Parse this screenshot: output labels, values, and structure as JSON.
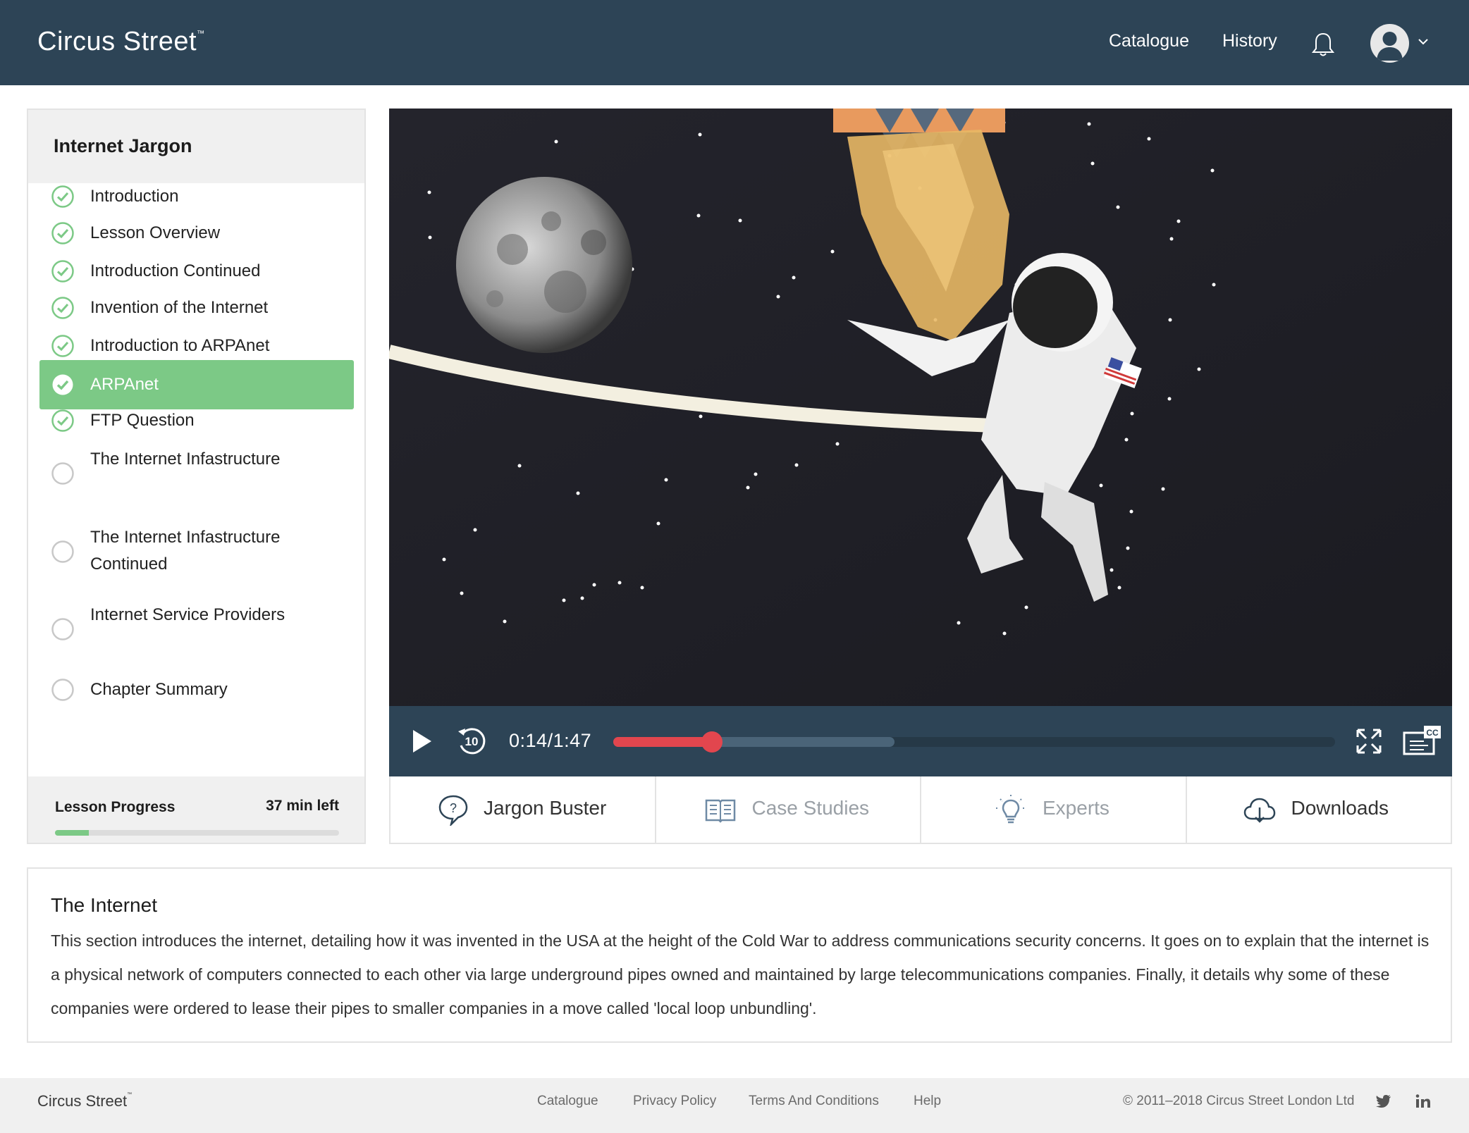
{
  "header": {
    "logo": "Circus Street",
    "logo_mark": "™",
    "nav": [
      {
        "label": "Catalogue"
      },
      {
        "label": "History"
      }
    ],
    "bell_icon": "bell-icon",
    "avatar_icon": "user-avatar-icon"
  },
  "sidebar": {
    "title": "Internet Jargon",
    "lessons": [
      {
        "label": "Introduction",
        "status": "completed"
      },
      {
        "label": "Lesson Overview",
        "status": "completed"
      },
      {
        "label": "Introduction Continued",
        "status": "completed"
      },
      {
        "label": "Invention of the Internet",
        "status": "completed"
      },
      {
        "label": "Introduction to ARPAnet",
        "status": "completed"
      },
      {
        "label": "ARPAnet",
        "status": "current"
      },
      {
        "label": "FTP Question",
        "status": "completed"
      },
      {
        "label": "The Internet Infastructure",
        "status": "not-started"
      },
      {
        "label": "The Internet Infastructure Continued",
        "status": "not-started"
      },
      {
        "label": "Internet Service Providers",
        "status": "not-started"
      },
      {
        "label": "Chapter Summary",
        "status": "not-started"
      }
    ],
    "progress": {
      "label": "Lesson Progress",
      "remaining": "37 min left",
      "fraction": 0.12
    }
  },
  "player": {
    "current_time": "0:14",
    "separator": "/",
    "duration": "1:47",
    "played_fraction": 0.137,
    "buffered_fraction": 0.39,
    "rewind_label": "10",
    "cc_label": "CC"
  },
  "tabs": [
    {
      "label": "Jargon Buster",
      "icon": "question-bubble-icon"
    },
    {
      "label": "Case Studies",
      "icon": "book-icon"
    },
    {
      "label": "Experts",
      "icon": "lightbulb-icon"
    },
    {
      "label": "Downloads",
      "icon": "cloud-download-icon"
    }
  ],
  "description": {
    "title": "The Internet",
    "body": "This section introduces the internet, detailing how it was invented in the USA at the height of the Cold War to address communications security concerns. It goes on to explain that the internet is a physical network of computers connected to each other via large underground pipes owned and maintained by large telecommunications companies. Finally, it details why some of these companies were ordered to lease their pipes to smaller companies in a move called 'local loop unbundling'."
  },
  "footer": {
    "logo": "Circus Street",
    "logo_mark": "™",
    "links": [
      "Catalogue",
      "Privacy Policy",
      "Terms And Conditions",
      "Help"
    ],
    "copyright": "© 2011–2018 Circus Street London Ltd",
    "social": [
      "twitter-icon",
      "linkedin-icon"
    ]
  },
  "colors": {
    "header_bg": "#2d4456",
    "accent_green": "#7cc986",
    "seek_red": "#e2464e"
  }
}
